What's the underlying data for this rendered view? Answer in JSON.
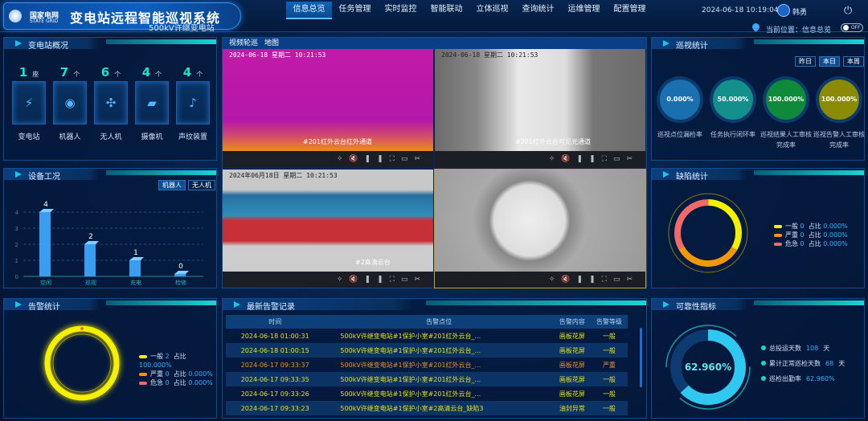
{
  "header": {
    "logo_cn": "国家电网",
    "logo_en": "STATE GRID",
    "title": "变电站远程智能巡视系统",
    "subtitle": "500kV许继变电站",
    "nav": [
      "信息总览",
      "任务管理",
      "实时监控",
      "智能联动",
      "立体巡视",
      "查询统计",
      "运维管理",
      "配置管理"
    ],
    "datetime": "2024-06-18 10:19:04",
    "user": "韩勇",
    "location": "当前位置：信息总览",
    "toggle": "OFF"
  },
  "overview": {
    "title": "变电站概况",
    "items": [
      {
        "count": "1",
        "unit": "座",
        "label": "变电站",
        "icon": "substation-icon",
        "glyph": "⚡"
      },
      {
        "count": "7",
        "unit": "个",
        "label": "机器人",
        "icon": "robot-icon",
        "glyph": "◉"
      },
      {
        "count": "6",
        "unit": "个",
        "label": "无人机",
        "icon": "drone-icon",
        "glyph": "✣"
      },
      {
        "count": "4",
        "unit": "个",
        "label": "摄像机",
        "icon": "camera-icon",
        "glyph": "▰"
      },
      {
        "count": "4",
        "unit": "个",
        "label": "声纹装置",
        "icon": "microphone-icon",
        "glyph": "♪"
      }
    ]
  },
  "equipment": {
    "title": "设备工况",
    "tabs": [
      "机器人",
      "无人机"
    ]
  },
  "chart_data": {
    "type": "bar",
    "title": "设备工况",
    "categories": [
      "空闲",
      "巡视",
      "充电",
      "检修"
    ],
    "values": [
      4,
      2,
      1,
      0
    ],
    "ylim": [
      0,
      4
    ],
    "yticks": [
      "0",
      "1",
      "2",
      "3",
      "4"
    ]
  },
  "video": {
    "tabs": [
      "视频轮巡",
      "地图"
    ],
    "cells": [
      {
        "ts": "2024-06-18 星期二 10:21:53",
        "cap": "#201红外云台红外通道"
      },
      {
        "ts": "2024-06-18 星期二 10:21:53",
        "cap": "#201红外云台可见光通道"
      },
      {
        "ts": "2024年06月18日 星期二 10:21:53",
        "cap": "#2高清云台"
      },
      {
        "ts": "",
        "cap": ""
      }
    ]
  },
  "alarm_stats": {
    "title": "告警统计",
    "legend": [
      {
        "name": "一般",
        "count": "2",
        "label": "占比",
        "pct": "100.000%",
        "color": "#f5f000"
      },
      {
        "name": "严重",
        "count": "0",
        "label": "占比",
        "pct": "0.000%",
        "color": "#f0980a"
      },
      {
        "name": "危急",
        "count": "0",
        "label": "占比",
        "pct": "0.000%",
        "color": "#f06a6a"
      }
    ]
  },
  "alarms": {
    "title": "最新告警记录",
    "columns": [
      "时间",
      "告警点位",
      "告警内容",
      "告警等级"
    ],
    "rows": [
      [
        "2024-06-18 01:00:31",
        "500kV许继变电站#1保护小室#201红外云台_...",
        "画板花屏",
        "一般"
      ],
      [
        "2024-06-18 01:00:15",
        "500kV许继变电站#1保护小室#201红外云台_...",
        "画板花屏",
        "一般"
      ],
      [
        "2024-06-17 09:33:37",
        "500kV许继变电站#1保护小室#201红外云台_...",
        "画板花屏",
        "严重"
      ],
      [
        "2024-06-17 09:33:35",
        "500kV许继变电站#1保护小室#201红外云台_...",
        "画板花屏",
        "一般"
      ],
      [
        "2024-06-17 09:33:26",
        "500kV许继变电站#1保护小室#201红外云台_...",
        "画板花屏",
        "一般"
      ],
      [
        "2024-06-17 09:33:23",
        "500kV许继变电站#1保护小室#2高清云台_缺陷3",
        "油封异常",
        "一般"
      ]
    ]
  },
  "patrol": {
    "title": "巡视统计",
    "tabs": [
      "昨日",
      "本日",
      "本周"
    ],
    "gauges": [
      {
        "value": "0.000%",
        "label": "巡视点位漏检率",
        "color": "#1a6fae"
      },
      {
        "value": "50.000%",
        "label": "任务执行闭环率",
        "color": "#138f8c"
      },
      {
        "value": "100.000%",
        "label": "巡视结果人工审核完成率",
        "color": "#0f8a3a"
      },
      {
        "value": "100.000%",
        "label": "巡视告警人工审核完成率",
        "color": "#8a8a05"
      }
    ]
  },
  "defects": {
    "title": "缺陷统计",
    "legend": [
      {
        "name": "一般",
        "count": "0",
        "label": "占比",
        "pct": "0.000%",
        "color": "#f5f000"
      },
      {
        "name": "严重",
        "count": "0",
        "label": "占比",
        "pct": "0.000%",
        "color": "#f0980a"
      },
      {
        "name": "危急",
        "count": "0",
        "label": "占比",
        "pct": "0.000%",
        "color": "#f06a6a"
      }
    ]
  },
  "reliability": {
    "title": "可靠性指标",
    "center": "62.960%",
    "percent": 62.96,
    "items": [
      {
        "label": "总投运天数",
        "value": "108",
        "unit": "天"
      },
      {
        "label": "累计正常巡检天数",
        "value": "68",
        "unit": "天"
      },
      {
        "label": "巡检出勤率",
        "value": "62.960%",
        "unit": ""
      }
    ]
  }
}
